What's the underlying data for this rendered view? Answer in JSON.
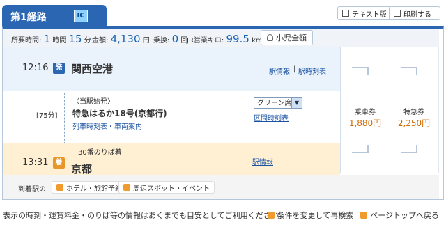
{
  "tab": {
    "title": "第1経路",
    "ic": "IC"
  },
  "toolbar": {
    "text_version": "テキスト版",
    "print": "印刷する"
  },
  "summary": {
    "duration_label": "所要時間:",
    "duration_h": "1",
    "duration_h_unit": "時間",
    "duration_m": "15",
    "duration_m_unit": "分",
    "fare_label": "金額:",
    "fare": "4,130",
    "fare_unit": "円",
    "transfers_label": "乗換:",
    "transfers": "0",
    "transfers_unit": "回",
    "jr_km_label": "JR営業キロ:",
    "jr_km": "99.5",
    "jr_km_unit": "km",
    "kids_button": "小児全額"
  },
  "departure": {
    "time": "12:16",
    "badge": "発",
    "station": "関西空港",
    "link1": "駅情報",
    "sep": "|",
    "link2": "駅時刻表"
  },
  "leg": {
    "origin_note": "〈当駅始発〉",
    "minutes": "[75分]",
    "train": "特急はるか18号(京都行)",
    "link_timetable": "列車時刻表・車両案内",
    "seat_select": "グリーン席",
    "link_interval": "区間時刻表"
  },
  "arrival": {
    "platform": "30番のりば着",
    "time": "13:31",
    "badge": "着",
    "station": "京都",
    "link": "駅情報"
  },
  "fares": {
    "ticket_label": "乗車券",
    "ticket_value": "1,880円",
    "express_label": "特急券",
    "express_value": "2,250円"
  },
  "footer": {
    "arrival_label": "到着駅の",
    "hotel": "ホテル・旅館予約",
    "spots": "周辺スポット・イベント"
  },
  "note": "表示の時刻・運賃料金・のりば等の情報はあくまでも目安としてご利用ください。",
  "bottom": {
    "research": "条件を変更して再検索",
    "top": "ページトップへ戻る"
  },
  "colors": {
    "brand": "#2a66b2",
    "accent": "#d06a00",
    "arrival_bg": "#fff0d3",
    "departure_bg": "#eaf2fb"
  }
}
